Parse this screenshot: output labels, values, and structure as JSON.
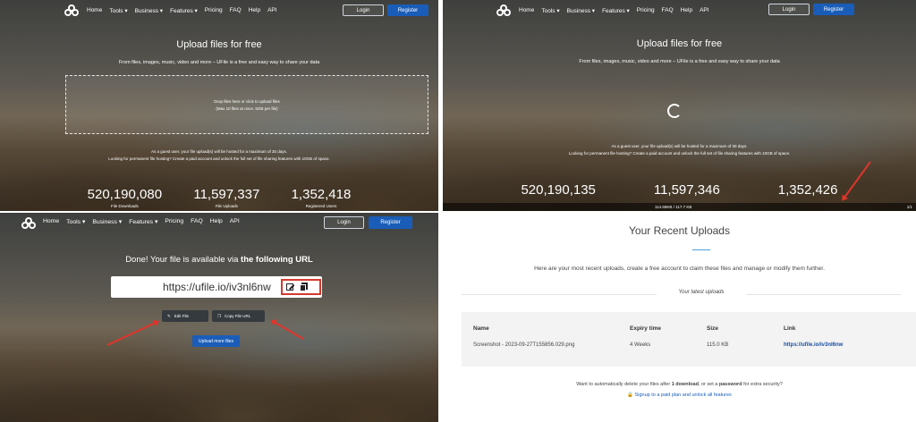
{
  "nav": {
    "menu": [
      "Home",
      "Tools",
      "Business",
      "Features",
      "Pricing",
      "FAQ",
      "Help",
      "API"
    ],
    "login": "Login",
    "register": "Register"
  },
  "hero": {
    "title": "Upload files for free",
    "subtitle": "From files, images, music, video and more – UFile is a free and easy way to share your data"
  },
  "dropzone": {
    "line1": "Drop files here or click to upload files",
    "line2": "(Max 10 files at once, 5GB per file)"
  },
  "guest_info": {
    "line1": "As a guest user, your file upload(s) will be hosted for a maximum of 30 days.",
    "line2": "Looking for permanent file hosting? Create a paid account and unlock the full set of file sharing features with 10GB of space."
  },
  "stats_before": [
    {
      "value": "520,190,080",
      "label": "File Downloads"
    },
    {
      "value": "11,597,337",
      "label": "File Uploads"
    },
    {
      "value": "1,352,418",
      "label": "Registered Users"
    }
  ],
  "stats_after": [
    {
      "value": "520,190,135"
    },
    {
      "value": "11,597,346"
    },
    {
      "value": "1,352,426"
    }
  ],
  "progress": {
    "text": "114.69KB / 117.7 KB",
    "counter": "1/1"
  },
  "done": {
    "prefix": "Done! Your file is available via ",
    "bold": "the following URL",
    "url": "https://ufile.io/iv3nl6nw",
    "edit_label": "Edit File",
    "copy_label": "Copy File URL",
    "upload_more": "Upload more files"
  },
  "recent": {
    "title": "Your Recent Uploads",
    "description": "Here are your most recent uploads, create a free account to claim these files and manage or modify them further.",
    "latest": "Your latest uploads",
    "headers": [
      "Name",
      "Expiry time",
      "Size",
      "Link"
    ],
    "row": [
      "Screenshot - 2023-09-27T155856.029.png",
      "4 Weeks",
      "115.0 KB",
      "https://ufile.io/iv3nl6nw"
    ],
    "footer_pre": "Want to automatically delete your files after ",
    "footer_b1": "1 download",
    "footer_mid": ", or set a ",
    "footer_b2": "password",
    "footer_post": " for extra security?",
    "signup": "Signup to a paid plan and unlock all features"
  },
  "colors": {
    "accent_blue": "#1a5db8",
    "annotation_red": "#e0342b"
  }
}
